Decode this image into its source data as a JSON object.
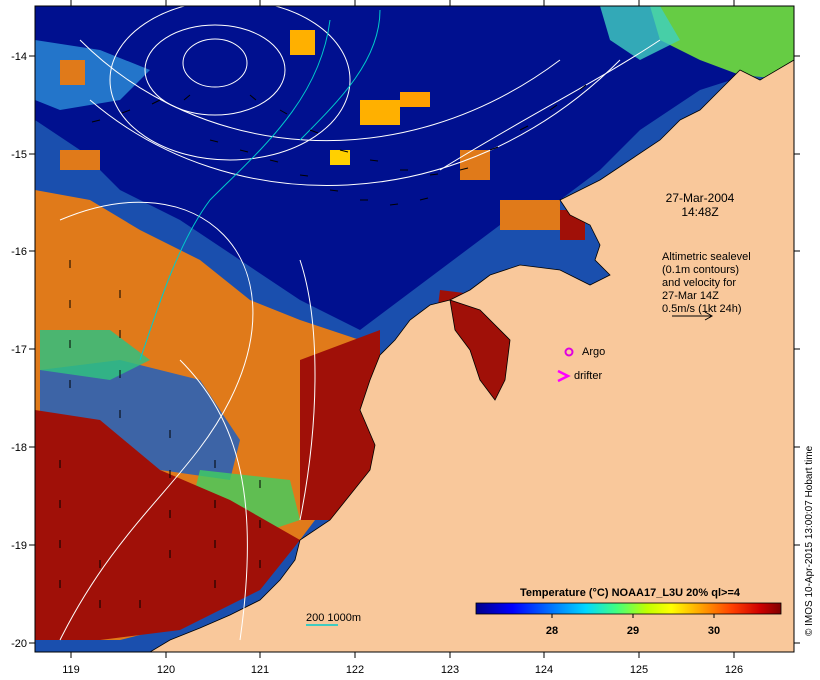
{
  "map": {
    "date": "27-Mar-2004",
    "time": "14:48Z",
    "altimetry_note": [
      "Altimetric sealevel",
      "(0.1m contours)",
      "and velocity for",
      "27-Mar 14Z",
      "0.5m/s (1kt 24h)"
    ],
    "legend_argo": "Argo",
    "legend_drifter": "drifter",
    "scale_label": "200  1000m",
    "credit": "© IMOS 10-Apr-2015 13:00:07 Hobart time",
    "x_ticks": [
      "119",
      "120",
      "121",
      "122",
      "123",
      "124",
      "125",
      "126"
    ],
    "y_ticks": [
      "-14",
      "-15",
      "-16",
      "-17",
      "-18",
      "-19",
      "-20"
    ],
    "colorbar": {
      "title": "Temperature (°C) NOAA17_L3U 20% ql>=4",
      "ticks": [
        "28",
        "29",
        "30"
      ],
      "range": [
        27.2,
        30.7
      ]
    },
    "colors": {
      "land": "#f9c89b",
      "argo": "#e000e0",
      "drifter": "#ff00ff",
      "scale_200m": "#00cccc",
      "contour": "#ffffff"
    }
  }
}
